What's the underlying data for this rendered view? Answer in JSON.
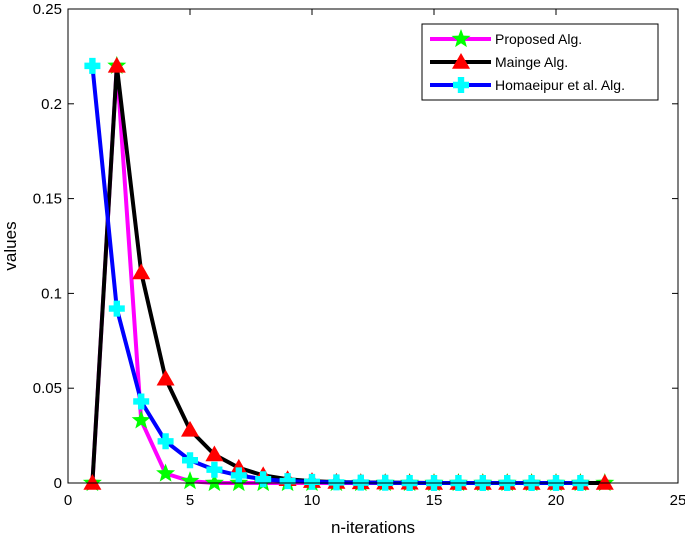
{
  "chart_data": {
    "type": "line",
    "title": "",
    "xlabel": "n-iterations",
    "ylabel": "values",
    "xlim": [
      0,
      25
    ],
    "ylim": [
      0,
      0.25
    ],
    "xticks": [
      "0",
      "5",
      "10",
      "15",
      "20",
      "25"
    ],
    "yticks": [
      "0",
      "0.05",
      "0.1",
      "0.15",
      "0.2",
      "0.25"
    ],
    "grid": false,
    "legend_position": "top-right",
    "series": [
      {
        "name": "Proposed Alg.",
        "line_color": "#ff00ff",
        "marker": "star",
        "marker_color": "#00ff00",
        "x": [
          1,
          2,
          3,
          4,
          5,
          6,
          7,
          8,
          9,
          10,
          11,
          12,
          13,
          14,
          15,
          16,
          17,
          18,
          19,
          20,
          21,
          22
        ],
        "y": [
          0,
          0.22,
          0.033,
          0.005,
          0.001,
          0,
          0,
          0,
          0,
          0,
          0,
          0,
          0,
          0,
          0,
          0,
          0,
          0,
          0,
          0,
          0,
          0
        ]
      },
      {
        "name": "Mainge Alg.",
        "line_color": "#000000",
        "marker": "triangle",
        "marker_color": "#ff0000",
        "x": [
          1,
          2,
          3,
          4,
          5,
          6,
          7,
          8,
          9,
          10,
          11,
          12,
          13,
          14,
          15,
          16,
          17,
          18,
          19,
          20,
          21,
          22
        ],
        "y": [
          0,
          0.22,
          0.111,
          0.055,
          0.028,
          0.015,
          0.008,
          0.004,
          0.002,
          0.001,
          0.0005,
          0.0003,
          0.0002,
          0.0001,
          0,
          0,
          0,
          0,
          0,
          0,
          0,
          0
        ]
      },
      {
        "name": "Homaeipur et al. Alg.",
        "line_color": "#0000ff",
        "marker": "plus",
        "marker_color": "#00ffff",
        "x": [
          1,
          2,
          3,
          4,
          5,
          6,
          7,
          8,
          9,
          10,
          11,
          12,
          13,
          14,
          15,
          16,
          17,
          18,
          19,
          20,
          21
        ],
        "y": [
          0.22,
          0.092,
          0.043,
          0.022,
          0.012,
          0.007,
          0.004,
          0.002,
          0.001,
          0.0006,
          0.0003,
          0.0002,
          0.0001,
          0,
          0,
          0,
          0,
          0,
          0,
          0,
          0
        ]
      }
    ]
  }
}
